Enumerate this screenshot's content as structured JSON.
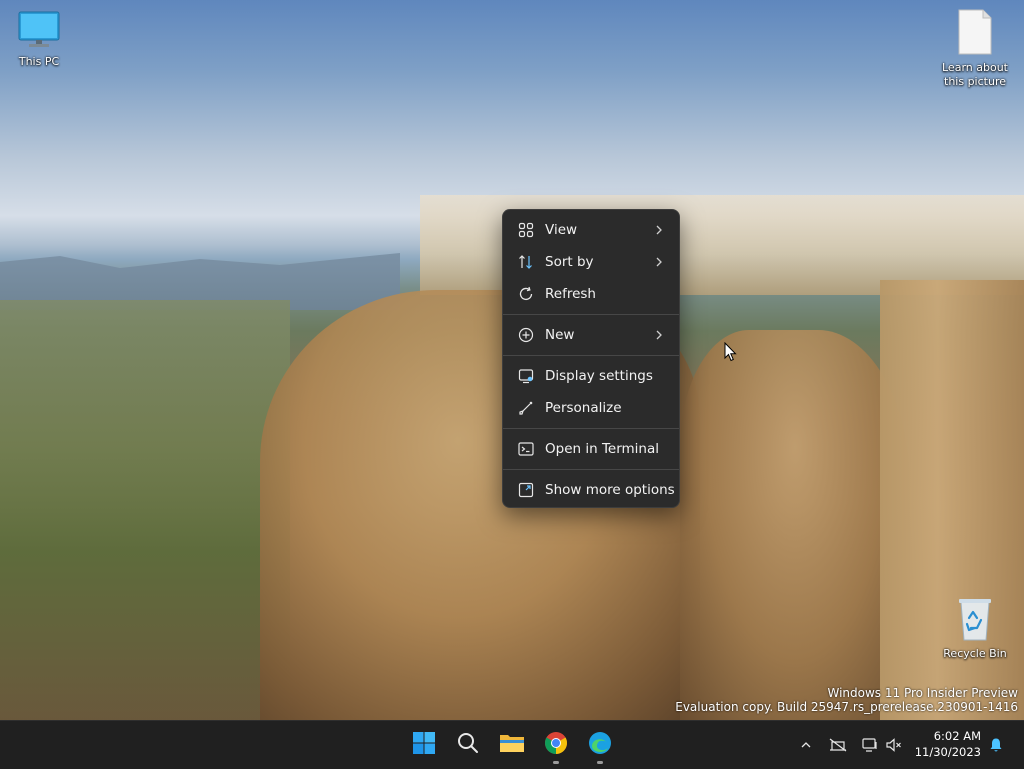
{
  "desktop": {
    "icons": [
      {
        "label": "This PC",
        "icon": "monitor-icon"
      },
      {
        "label": "Learn about this picture",
        "icon": "document-icon"
      },
      {
        "label": "Recycle Bin",
        "icon": "recycle-bin-icon"
      }
    ],
    "watermark": {
      "line1": "Windows 11 Pro Insider Preview",
      "line2": "Evaluation copy. Build 25947.rs_prerelease.230901-1416"
    }
  },
  "context_menu": {
    "items": [
      {
        "label": "View",
        "icon": "grid-icon",
        "submenu": true
      },
      {
        "label": "Sort by",
        "icon": "sort-icon",
        "submenu": true
      },
      {
        "label": "Refresh",
        "icon": "refresh-icon",
        "submenu": false
      },
      {
        "label": "New",
        "icon": "plus-circle-icon",
        "submenu": true
      },
      {
        "label": "Display settings",
        "icon": "display-icon",
        "submenu": false
      },
      {
        "label": "Personalize",
        "icon": "brush-icon",
        "submenu": false
      },
      {
        "label": "Open in Terminal",
        "icon": "terminal-icon",
        "submenu": false
      },
      {
        "label": "Show more options",
        "icon": "expand-icon",
        "submenu": false
      }
    ]
  },
  "taskbar": {
    "apps": [
      {
        "name": "Start",
        "icon": "windows-start-icon"
      },
      {
        "name": "Search",
        "icon": "search-icon"
      },
      {
        "name": "File Explorer",
        "icon": "folder-icon"
      },
      {
        "name": "Google Chrome",
        "icon": "chrome-icon"
      },
      {
        "name": "Microsoft Edge",
        "icon": "edge-icon"
      }
    ],
    "tray": {
      "time": "6:02 AM",
      "date": "11/30/2023",
      "icons": [
        "chevron-up-icon",
        "network-off-icon",
        "display-device-icon",
        "volume-muted-icon",
        "notification-bell-icon"
      ]
    }
  },
  "colors": {
    "menu_bg": "#2b2b2b",
    "taskbar_bg": "#202020",
    "accent": "#4cc2ff"
  }
}
